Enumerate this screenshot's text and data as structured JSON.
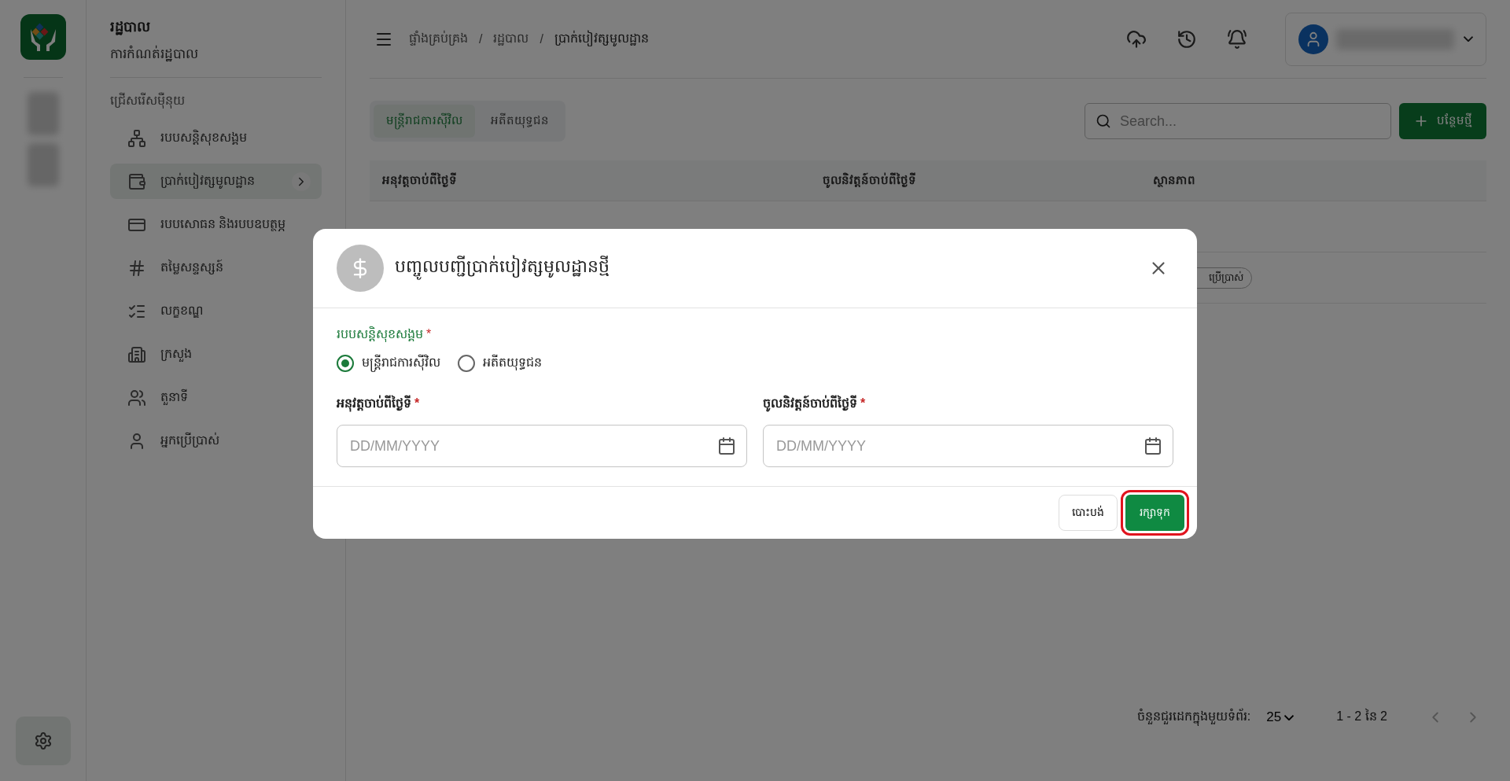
{
  "app": {
    "title": "រដ្ឋបាល",
    "subtitle": "ការកំណត់រដ្ឋបាល"
  },
  "sidebar": {
    "section": "ជ្រើសរើសម៉ឺនុយ",
    "items": [
      {
        "label": "របបសន្តិសុខសង្គម",
        "selected": false
      },
      {
        "label": "ប្រាក់បៀវត្សមូលដ្ឋាន",
        "selected": true
      },
      {
        "label": "របបសោធន និងរបបឧបត្ថម្ភ",
        "selected": false
      },
      {
        "label": "តម្លៃសន្ទស្សន៍",
        "selected": false
      },
      {
        "label": "លក្ខខណ្ឌ",
        "selected": false
      },
      {
        "label": "ក្រសួង",
        "selected": false
      },
      {
        "label": "តួនាទី",
        "selected": false
      },
      {
        "label": "អ្នកប្រើប្រាស់",
        "selected": false
      }
    ]
  },
  "breadcrumbs": [
    "ផ្ទាំងគ្រប់គ្រង",
    "រដ្ឋបាល",
    "ប្រាក់បៀវត្សមូលដ្ឋាន"
  ],
  "breadcrumb_separator": "/",
  "tabs": [
    {
      "label": "មន្ត្រីរាជការស៊ីវិល",
      "selected": true
    },
    {
      "label": "អតីតយុទ្ធជន",
      "selected": false
    }
  ],
  "search": {
    "placeholder": "Search..."
  },
  "add_button": "បន្ថែមថ្មី",
  "table": {
    "columns": [
      "អនុវត្តចាប់ពីថ្ងៃទី",
      "ចូលនិវត្តន៍ចាប់ពីថ្ងៃទី",
      "ស្ថានភាព"
    ],
    "rows": [
      {
        "status": "ប្រើប្រាស់"
      }
    ]
  },
  "pagination": {
    "rows_per_page_label": "ចំនួនជួរដេកក្នុងមួយទំព័រ:",
    "rows_per_page": "25",
    "range": "1 - 2 នៃ 2"
  },
  "dialog": {
    "title": "បញ្ចូលបញ្ជីប្រាក់បៀវត្សមូលដ្ឋានថ្មី",
    "group_label": "របបសន្តិសុខសង្គម",
    "required_mark": "*",
    "options": [
      {
        "label": "មន្ត្រីរាជការស៊ីវិល",
        "selected": true
      },
      {
        "label": "អតីតយុទ្ធជន",
        "selected": false
      }
    ],
    "fields": [
      {
        "label": "អនុវត្តចាប់ពីថ្ងៃទី",
        "placeholder": "DD/MM/YYYY"
      },
      {
        "label": "ចូលនិវត្តន៍ចាប់ពីថ្ងៃទី",
        "placeholder": "DD/MM/YYYY"
      }
    ],
    "cancel": "បោះបង់",
    "save": "រក្សាទុក",
    "save_highlighted": true
  }
}
